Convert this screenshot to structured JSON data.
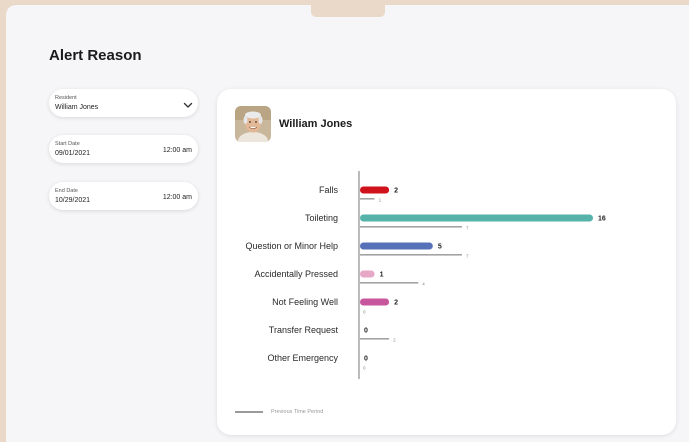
{
  "page": {
    "title": "Alert Reason"
  },
  "filters": {
    "resident": {
      "label": "Resident",
      "value": "William Jones"
    },
    "start_date": {
      "label": "Start Date",
      "date": "09/01/2021",
      "time": "12:00 am"
    },
    "end_date": {
      "label": "End Date",
      "date": "10/29/2021",
      "time": "12:00 am"
    }
  },
  "card": {
    "resident_name": "William Jones"
  },
  "legend": {
    "previous_label": "Previous Time Period"
  },
  "colors": {
    "background": "#ead9c8",
    "previous_bar": "#a3a3a3"
  },
  "icons": {
    "resident_dropdown": "chevron-down-icon",
    "avatar": "resident-photo"
  },
  "chart_data": {
    "type": "bar",
    "orientation": "horizontal",
    "categories": [
      "Falls",
      "Toileting",
      "Question or Minor Help",
      "Accidentally Pressed",
      "Not Feeling Well",
      "Transfer Request",
      "Other Emergency"
    ],
    "series": [
      {
        "name": "",
        "values": [
          2,
          16,
          5,
          1,
          2,
          0,
          0
        ],
        "colors": [
          "#d0121d",
          "#55b3aa",
          "#5671b8",
          "#e7a7c6",
          "#c8569d",
          "#cccccc",
          "#cccccc"
        ]
      },
      {
        "name": "Previous Time Period",
        "values": [
          1,
          7,
          7,
          4,
          0,
          2,
          0
        ],
        "color": "#a3a3a3"
      }
    ],
    "xlim": [
      0,
      16
    ],
    "grid": false,
    "legend": "bottom-left"
  }
}
